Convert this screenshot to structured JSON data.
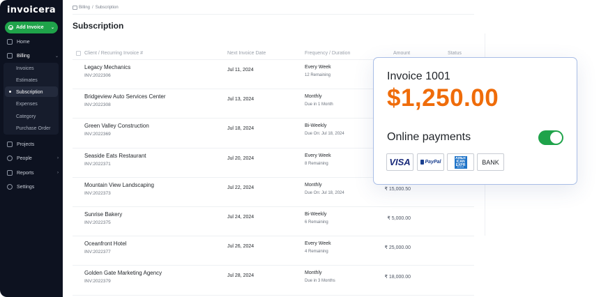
{
  "sidebar": {
    "logo": "invoicera",
    "add_button": "Add Invoice",
    "items": [
      {
        "label": "Home",
        "icon": "home-icon"
      },
      {
        "label": "Billing",
        "icon": "billing-icon"
      },
      {
        "label": "Projects",
        "icon": "folder-icon"
      },
      {
        "label": "People",
        "icon": "people-icon"
      },
      {
        "label": "Reports",
        "icon": "reports-icon"
      },
      {
        "label": "Settings",
        "icon": "gear-icon"
      }
    ],
    "billing_sub": [
      "Invoices",
      "Estimates",
      "Subscription",
      "Expenses",
      "Category",
      "Purchase Order"
    ]
  },
  "breadcrumb": {
    "billing": "Billing",
    "sep": "/",
    "current": "Subscription"
  },
  "page_title": "Subscription",
  "table": {
    "headers": [
      "Client / Recurring Invoice #",
      "Next Invoice Date",
      "Frequency / Duration",
      "Amount",
      "Status"
    ],
    "rows": [
      {
        "client": "Legacy Mechanics",
        "inv": "INV:2022306",
        "date": "Jul 11, 2024",
        "freq": "Every Week",
        "freq_sub": "12 Remaining",
        "amount": ""
      },
      {
        "client": "Bridgeview Auto Services Center",
        "inv": "INV:2022308",
        "date": "Jul 13, 2024",
        "freq": "Monthly",
        "freq_sub": "Due in 1 Month",
        "amount": ""
      },
      {
        "client": "Green Valley Construction",
        "inv": "INV:2022369",
        "date": "Jul 18, 2024",
        "freq": "Bi-Weekly",
        "freq_sub": "Due On: Jul 18, 2024",
        "amount": ""
      },
      {
        "client": "Seaside Eats Restaurant",
        "inv": "INV:2022371",
        "date": "Jul 20, 2024",
        "freq": "Every Week",
        "freq_sub": "8 Remaining",
        "amount": ""
      },
      {
        "client": "Mountain View Landscaping",
        "inv": "INV:2022373",
        "date": "Jul 22, 2024",
        "freq": "Monthly",
        "freq_sub": "Due On: Jul 18, 2024",
        "amount": "₹ 15,000.50"
      },
      {
        "client": "Sunrise Bakery",
        "inv": "INV:2022375",
        "date": "Jul 24, 2024",
        "freq": "Bi-Weekly",
        "freq_sub": "6 Remaining",
        "amount": "₹ 5,000.00"
      },
      {
        "client": "Oceanfront Hotel",
        "inv": "INV:2022377",
        "date": "Jul 26, 2024",
        "freq": "Every Week",
        "freq_sub": "4 Remaining",
        "amount": "₹ 25,000.00"
      },
      {
        "client": "Golden Gate Marketing Agency",
        "inv": "INV:2022379",
        "date": "Jul 28, 2024",
        "freq": "Monthly",
        "freq_sub": "Due in 3 Months",
        "amount": "₹ 18,000.00"
      }
    ]
  },
  "card": {
    "title": "Invoice 1001",
    "amount": "$1,250.00",
    "online_label": "Online payments",
    "online_enabled": true,
    "methods": {
      "visa": "VISA",
      "paypal": "PayPal",
      "amex": "AMERICAN EXPRESS",
      "bank": "BANK"
    },
    "accent": "#ef6c0a",
    "toggle_color": "#1fa34a"
  }
}
